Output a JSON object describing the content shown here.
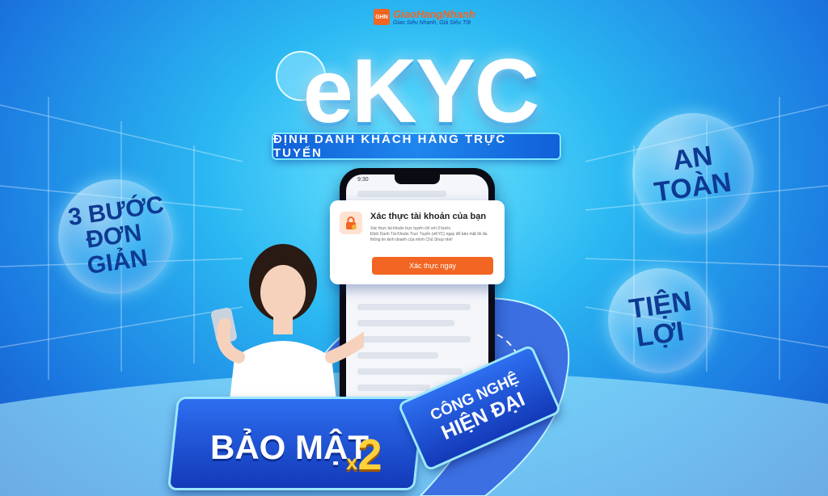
{
  "brand": {
    "logo_mark": "GHN",
    "name": "GiaoHangNhanh",
    "tagline": "Giao Siêu Nhanh, Giá Siêu Tốt"
  },
  "headline": {
    "title": "eKYC",
    "subtitle": "ĐỊNH DANH KHÁCH HÀNG TRỰC TUYẾN"
  },
  "bubbles": [
    {
      "line1": "3 BƯỚC",
      "line2": "ĐƠN GIẢN"
    },
    {
      "line1": "AN",
      "line2": "TOÀN"
    },
    {
      "line1": "TIỆN",
      "line2": "LỢI"
    }
  ],
  "phone": {
    "status_time": "9:30"
  },
  "card": {
    "icon": "lock-shield-icon",
    "title": "Xác thực tài khoản của bạn",
    "desc1": "Xác thực tài khoản trực tuyến chỉ với 3 bước.",
    "desc2": "Định Danh Tài Khoản Trực Tuyến (eKYC) ngay để bảo mật tối đa thông tin kinh doanh của mình Chủ Shop nhé!",
    "button": "Xác thực ngay"
  },
  "banners": {
    "security": "BẢO MẬT",
    "multiplier_x": "x",
    "multiplier_n": "2",
    "tech_line1": "CÔNG NGHỆ",
    "tech_line2": "HIỆN ĐẠI"
  },
  "colors": {
    "brand_orange": "#f26522",
    "deep_blue": "#0d3a92",
    "accent_yellow": "#ffd13b"
  }
}
